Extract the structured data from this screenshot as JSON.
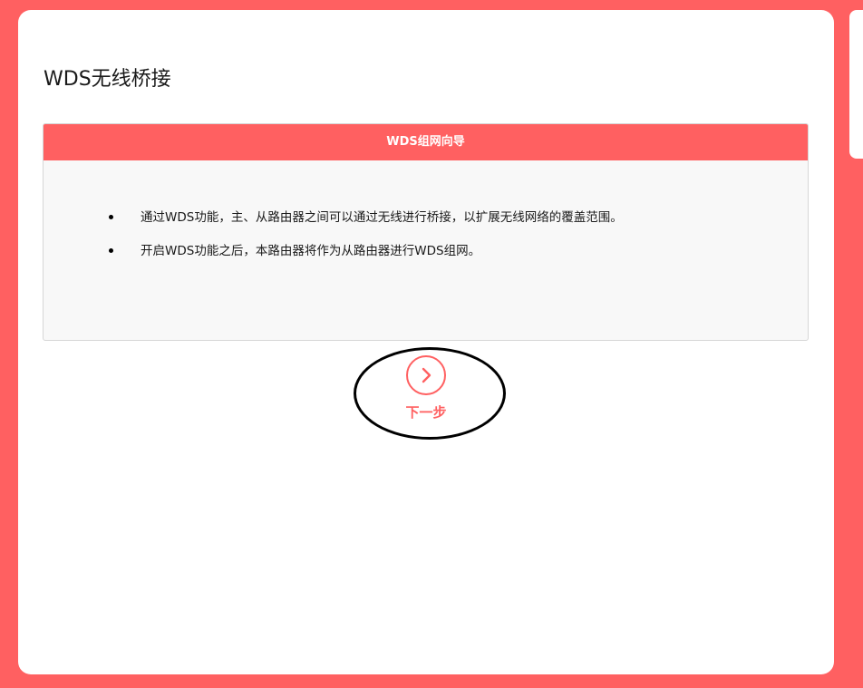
{
  "page": {
    "title": "WDS无线桥接"
  },
  "wizard": {
    "header": "WDS组网向导",
    "items": [
      {
        "text": "通过WDS功能，主、从路由器之间可以通过无线进行桥接，以扩展无线网络的覆盖范围。"
      },
      {
        "text": "开启WDS功能之后，本路由器将作为从路由器进行WDS组网。"
      }
    ]
  },
  "next_button": {
    "label": "下一步",
    "icon": "chevron-right-icon"
  },
  "colors": {
    "accent": "#ff6061",
    "panel": "#ffffff",
    "box_background": "#f8f8f8"
  }
}
